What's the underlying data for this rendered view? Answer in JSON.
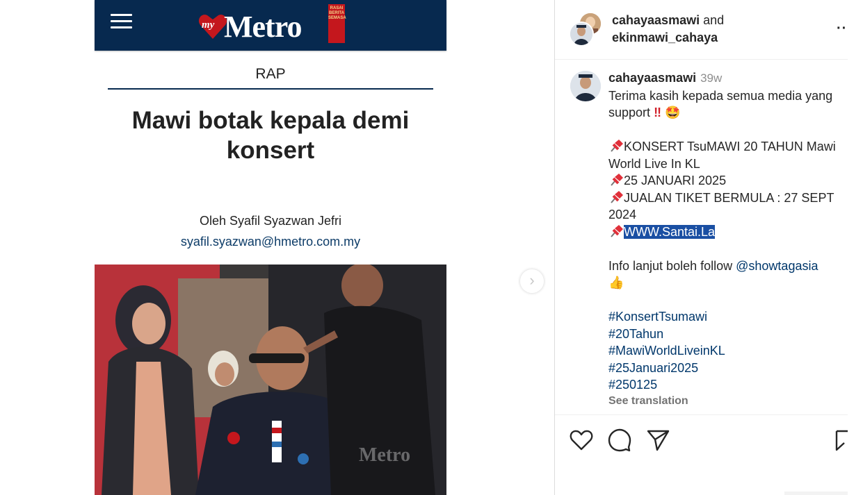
{
  "article": {
    "logo_my": "my",
    "logo_name": "Metro",
    "logo_flag": "RASAI BERITA SEMASA",
    "section": "RAP",
    "headline": "Mawi botak kepala demi konsert",
    "byline": "Oleh Syafil Syazwan Jefri",
    "email": "syafil.syazwan@hmetro.com.my",
    "photo_watermark": "Metro"
  },
  "post": {
    "header": {
      "user1": "cahayaasmawi",
      "and": "and",
      "user2": "ekinmawi_cahaya",
      "more": "··"
    },
    "caption": {
      "username": "cahayaasmawi",
      "time": "39w",
      "line1": "Terima kasih kepada semua media yang support",
      "item1": "KONSERT TsuMAWI 20 TAHUN Mawi World Live In KL",
      "item2": "25 JANUARI 2025",
      "item3": "JUALAN TIKET BERMULA : 27 SEPT 2024",
      "item4": "WWW.Santai.La",
      "info": "Info lanjut boleh follow",
      "mention": "@showtagasia",
      "hashtags": [
        "#KonsertTsumawi",
        "#20Tahun",
        "#MawiWorldLiveinKL",
        "#25Januari2025",
        "#250125"
      ],
      "see_translation": "See translation"
    }
  },
  "icons": {
    "like": "heart-icon",
    "comment": "comment-icon",
    "share": "send-icon",
    "save": "bookmark-icon",
    "next": "chevron-right-icon",
    "menu": "hamburger-icon"
  },
  "colors": {
    "metro_navy": "#07294f",
    "metro_red": "#c4171d",
    "link_blue": "#00376b",
    "selection": "#1a4fa3"
  }
}
